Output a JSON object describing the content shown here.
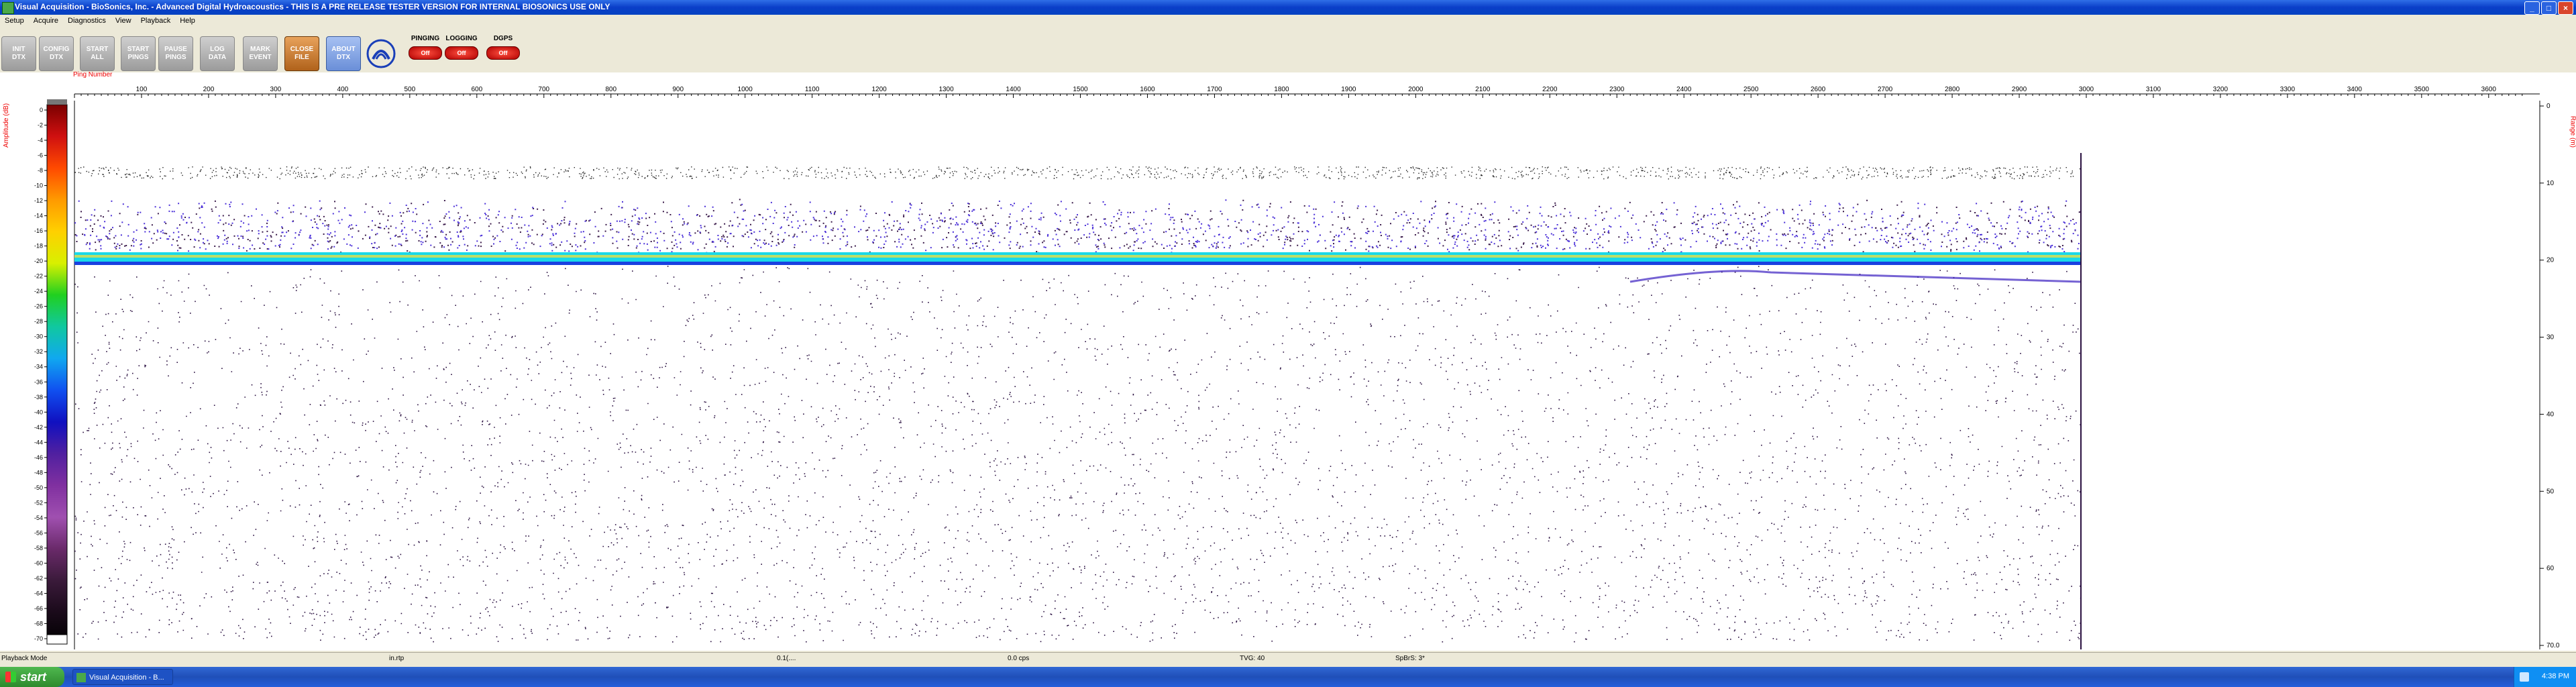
{
  "window": {
    "title": "Visual Acquisition  -  BioSonics, Inc.  -  Advanced Digital Hydroacoustics  -  THIS IS A PRE RELEASE TESTER VERSION FOR INTERNAL BIOSONICS USE ONLY",
    "min": "_",
    "max": "□",
    "close": "×"
  },
  "menu": [
    "Setup",
    "Acquire",
    "Diagnostics",
    "View",
    "Playback",
    "Help"
  ],
  "toolbar": {
    "buttons": [
      {
        "label": "INIT\nDTX",
        "style": "grey"
      },
      {
        "label": "CONFIG\nDTX",
        "style": "grey"
      },
      {
        "label": "START\nALL",
        "style": "grey"
      },
      {
        "label": "START\nPINGS",
        "style": "grey"
      },
      {
        "label": "PAUSE\nPINGS",
        "style": "grey"
      },
      {
        "label": "LOG\nDATA",
        "style": "grey"
      },
      {
        "label": "MARK\nEVENT",
        "style": "grey"
      },
      {
        "label": "CLOSE\nFILE",
        "style": "orange"
      },
      {
        "label": "ABOUT\nDTX",
        "style": "blue"
      }
    ],
    "indicators": [
      {
        "label": "PINGING",
        "state": "Off"
      },
      {
        "label": "LOGGING",
        "state": "Off"
      },
      {
        "label": "DGPS",
        "state": "Off"
      }
    ]
  },
  "echogram": {
    "ping_label": "Ping Number",
    "amp_label": "Amplitude (dB)",
    "range_label": "Range (m)",
    "ping_ticks": [
      "100",
      "200",
      "300",
      "400",
      "500",
      "600",
      "700",
      "800",
      "900",
      "1000",
      "1100",
      "1200",
      "1300",
      "1400",
      "1500",
      "1600",
      "1700",
      "1800",
      "1900",
      "2000",
      "2100",
      "2200",
      "2300",
      "2400",
      "2500",
      "2600",
      "2700",
      "2800",
      "2900",
      "3000",
      "3100",
      "3200",
      "3300",
      "3400",
      "3500",
      "3600"
    ],
    "amp_ticks": [
      "0",
      "-2",
      "-4",
      "-6",
      "-8",
      "-10",
      "-12",
      "-14",
      "-16",
      "-18",
      "-20",
      "-22",
      "-24",
      "-26",
      "-28",
      "-30",
      "-32",
      "-34",
      "-36",
      "-38",
      "-40",
      "-42",
      "-44",
      "-46",
      "-48",
      "-50",
      "-52",
      "-54",
      "-56",
      "-58",
      "-60",
      "-62",
      "-64",
      "-66",
      "-68",
      "-70"
    ],
    "range_ticks": [
      "0",
      "10",
      "20",
      "30",
      "40",
      "50",
      "60",
      "70.0"
    ],
    "colors": {
      "noise": "#3a1a4a",
      "school": "#4a2fd8",
      "bottom": "#19d9e8",
      "bottom_core": "#ffe033",
      "label_red": "#e00000"
    }
  },
  "status": {
    "mode": "Playback Mode",
    "c1": "in.rtp",
    "c2": "0.1(....",
    "c3": "0.0 cps",
    "c4": "TVG: 40",
    "c5": "SpBrS: 3*"
  },
  "taskbar": {
    "start": "start",
    "task": "Visual Acquisition  -  B...",
    "clock": "4:38 PM"
  }
}
